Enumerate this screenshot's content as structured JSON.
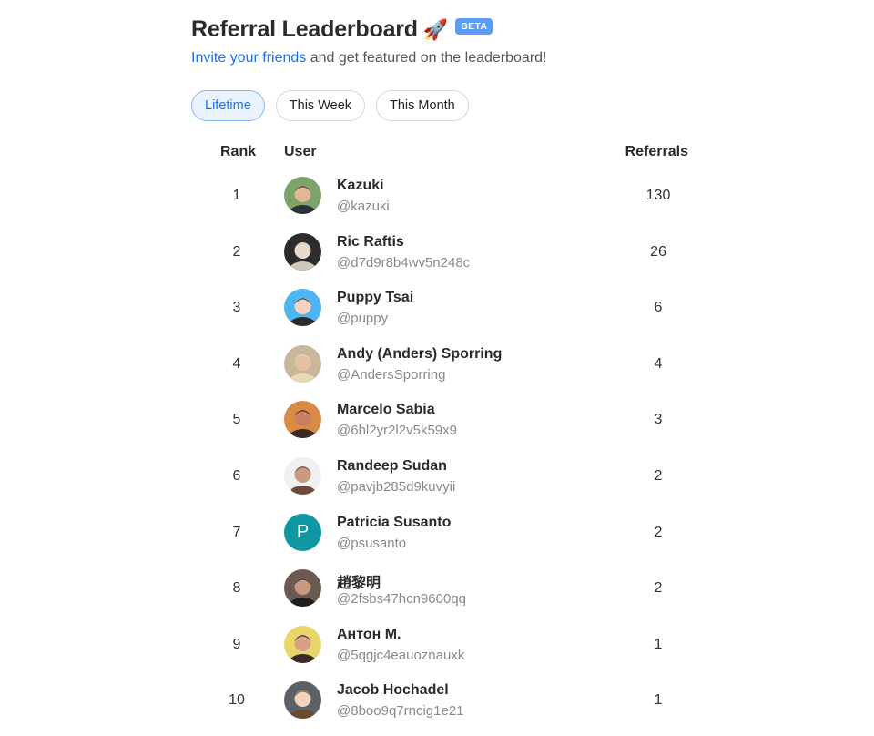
{
  "header": {
    "title": "Referral Leaderboard",
    "title_emoji": "🚀",
    "badge": "BETA",
    "subtitle_link": "Invite your friends",
    "subtitle_rest": " and get featured on the leaderboard!"
  },
  "colors": {
    "accent": "#1a73e8",
    "badge_bg": "#5b9cf6",
    "active_tab_bg": "#eaf2fe",
    "letter_avatar_bg": "#0f97a3"
  },
  "tabs": [
    {
      "label": "Lifetime",
      "active": true
    },
    {
      "label": "This Week",
      "active": false
    },
    {
      "label": "This Month",
      "active": false
    }
  ],
  "table": {
    "columns": {
      "rank": "Rank",
      "user": "User",
      "referrals": "Referrals"
    },
    "rows": [
      {
        "rank": "1",
        "name": "Kazuki",
        "handle": "@kazuki",
        "referrals": "130",
        "avatar": "photo"
      },
      {
        "rank": "2",
        "name": "Ric Raftis",
        "handle": "@d7d9r8b4wv5n248c",
        "referrals": "26",
        "avatar": "photo"
      },
      {
        "rank": "3",
        "name": "Puppy Tsai",
        "handle": "@puppy",
        "referrals": "6",
        "avatar": "photo"
      },
      {
        "rank": "4",
        "name": "Andy (Anders) Sporring",
        "handle": "@AndersSporring",
        "referrals": "4",
        "avatar": "photo"
      },
      {
        "rank": "5",
        "name": "Marcelo Sabia",
        "handle": "@6hl2yr2l2v5k59x9",
        "referrals": "3",
        "avatar": "photo"
      },
      {
        "rank": "6",
        "name": "Randeep Sudan",
        "handle": "@pavjb285d9kuvyii",
        "referrals": "2",
        "avatar": "photo"
      },
      {
        "rank": "7",
        "name": "Patricia Susanto",
        "handle": "@psusanto",
        "referrals": "2",
        "avatar": "letter",
        "avatar_letter": "P"
      },
      {
        "rank": "8",
        "name": "趙黎明",
        "handle": "@2fsbs47hcn9600qq",
        "referrals": "2",
        "avatar": "photo"
      },
      {
        "rank": "9",
        "name": "Антон М.",
        "handle": "@5qgjc4eauoznauxk",
        "referrals": "1",
        "avatar": "photo"
      },
      {
        "rank": "10",
        "name": "Jacob Hochadel",
        "handle": "@8boo9q7rncig1e21",
        "referrals": "1",
        "avatar": "photo"
      }
    ]
  }
}
